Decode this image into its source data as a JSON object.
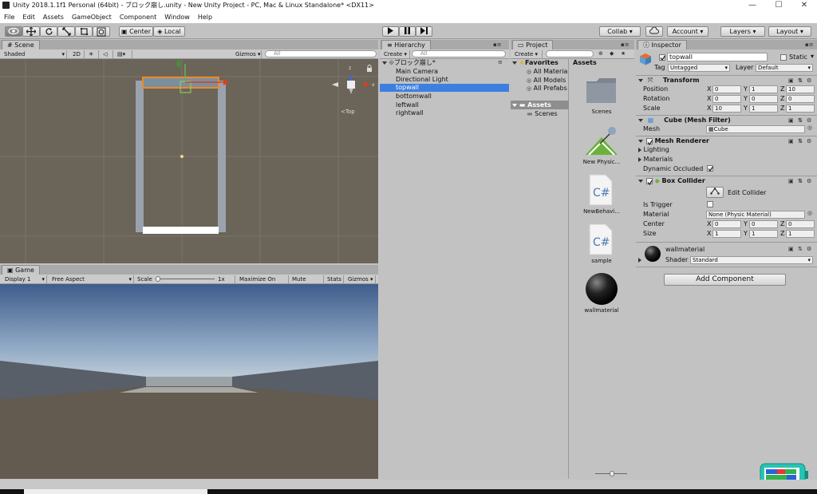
{
  "window": {
    "title": "Unity 2018.1.1f1 Personal (64bit) - ブロック崩し.unity - New Unity Project - PC, Mac & Linux Standalone* <DX11>",
    "minimize": "—",
    "maximize": "☐",
    "close": "✕"
  },
  "menu": [
    "File",
    "Edit",
    "Assets",
    "GameObject",
    "Component",
    "Window",
    "Help"
  ],
  "toolbar": {
    "pivot": "Center",
    "space": "Local",
    "collab": "Collab ▾",
    "account": "Account ▾",
    "layers": "Layers ▾",
    "layout": "Layout ▾"
  },
  "scene": {
    "tab": "Scene",
    "shading": "Shaded",
    "mode2d": "2D",
    "gizmos": "Gizmos ▾",
    "search": "All",
    "gizmo_label": "<Top"
  },
  "game": {
    "tab": "Game",
    "display": "Display 1",
    "aspect": "Free Aspect",
    "scale_label": "Scale",
    "scale_value": "1x",
    "maximize": "Maximize On Play",
    "mute": "Mute Audio",
    "stats": "Stats",
    "gizmos": "Gizmos ▾"
  },
  "hierarchy": {
    "tab": "Hierarchy",
    "create": "Create ▾",
    "search": "All",
    "scene_name": "ブロック崩し*",
    "items": [
      "Main Camera",
      "Directional Light",
      "topwall",
      "bottomwall",
      "leftwall",
      "rightwall"
    ],
    "selected_index": 2
  },
  "project": {
    "tab": "Project",
    "create": "Create ▾",
    "favorites": "Favorites",
    "fav_items": [
      "All Materia",
      "All Models",
      "All Prefabs"
    ],
    "assets_root": "Assets",
    "asset_folders": [
      "Scenes"
    ],
    "assets_header": "Assets",
    "assets": [
      "Scenes",
      "New Physic...",
      "NewBehavi...",
      "sample",
      "wallmaterial"
    ]
  },
  "inspector": {
    "tab": "Inspector",
    "object_name": "topwall",
    "static_label": "Static",
    "tag_label": "Tag",
    "tag_value": "Untagged",
    "layer_label": "Layer",
    "layer_value": "Default",
    "transform": {
      "title": "Transform",
      "position_label": "Position",
      "rotation_label": "Rotation",
      "scale_label": "Scale",
      "position": [
        "0",
        "1",
        "10"
      ],
      "rotation": [
        "0",
        "0",
        "0"
      ],
      "scale": [
        "10",
        "1",
        "1"
      ]
    },
    "mesh_filter": {
      "title": "Cube (Mesh Filter)",
      "mesh_label": "Mesh",
      "mesh_value": "Cube"
    },
    "mesh_renderer": {
      "title": "Mesh Renderer",
      "lighting": "Lighting",
      "materials": "Materials",
      "dynamic_occluded": "Dynamic Occluded"
    },
    "box_collider": {
      "title": "Box Collider",
      "edit_collider": "Edit Collider",
      "is_trigger": "Is Trigger",
      "material_label": "Material",
      "material_value": "None (Physic Material)",
      "center_label": "Center",
      "size_label": "Size",
      "center": [
        "0",
        "0",
        "0"
      ],
      "size": [
        "1",
        "1",
        "1"
      ]
    },
    "material": {
      "name": "wallmaterial",
      "shader_label": "Shader",
      "shader_value": "Standard"
    },
    "add_component": "Add Component"
  },
  "colors": {
    "selection": "#3d7fe0",
    "scene_bg": "#6b6459",
    "wall_orange": "#f08a24",
    "battery_teal": "#27c4b4"
  }
}
